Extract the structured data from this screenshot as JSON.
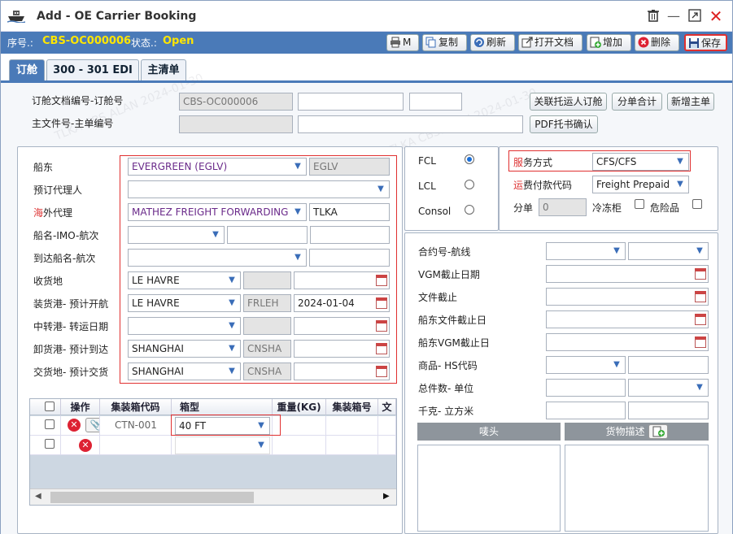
{
  "window": {
    "title_prefix": "Add",
    "title_sep": " - ",
    "title": "OE Carrier Booking"
  },
  "info": {
    "serial_label": "序号.:",
    "serial": "CBS-OC000006",
    "status_label": "状态.:",
    "status": "Open"
  },
  "toolbar": {
    "print": "M",
    "copy": "复制",
    "refresh": "刷新",
    "open_doc": "打开文档",
    "add": "增加",
    "delete": "删除",
    "save": "保存"
  },
  "tabs": [
    "订舱",
    "300 - 301 EDI",
    "主清单"
  ],
  "top": {
    "booking_doc_label": "订舱文档编号-订舱号",
    "booking_doc_no": "CBS-OC000006",
    "master_label": "主文件号-主单编号",
    "btn_link": "关联托运人订舱",
    "btn_sum": "分单合计",
    "btn_new_master": "新增主单",
    "btn_pdf": "PDF托书确认"
  },
  "left": {
    "carrier_label": "船东",
    "carrier": "EVERGREEN (EGLV)",
    "carrier_code": "EGLV",
    "agent_label": "预订代理人",
    "overseas_prefix": "海",
    "overseas_label": "外代理",
    "overseas": "MATHEZ FREIGHT FORWARDING",
    "overseas_code": "TLKA",
    "vessel_label": "船名-IMO-航次",
    "arrive_vessel_label": "到达船名-航次",
    "receipt_label": "收货地",
    "receipt": "LE HAVRE",
    "load_label": "装货港- 预计开航",
    "load": "LE HAVRE",
    "load_code": "FRLEH",
    "load_date": "2024-01-04",
    "trans_label": "中转港- 转运日期",
    "discharge_label": "卸货港- 预计到达",
    "discharge": "SHANGHAI",
    "discharge_code": "CNSHA",
    "delivery_label": "交货地- 预计交货",
    "delivery": "SHANGHAI",
    "delivery_code": "CNSHA"
  },
  "grid": {
    "headers": [
      "操作",
      "集装箱代码",
      "箱型",
      "重量(KG)",
      "集装箱号",
      "文"
    ],
    "rows": [
      {
        "code": "CTN-001",
        "type": "40 FT"
      },
      {
        "code": "",
        "type": ""
      }
    ]
  },
  "mode": {
    "fcl": "FCL",
    "lcl": "LCL",
    "consol": "Consol",
    "selected": "FCL"
  },
  "service": {
    "prefix": "服",
    "label": "务方式",
    "value": "CFS/CFS",
    "pay_prefix": "运",
    "pay_label": "费付款代码",
    "pay_value": "Freight Prepaid",
    "split_label": "分单",
    "split_value": "0",
    "reefer_label": "冷冻柜",
    "danger_label": "危险品"
  },
  "right": {
    "contract_label": "合约号-航线",
    "vgm_cut_label": "VGM截止日期",
    "doc_cut_label": "文件截止",
    "carrier_doc_cut_label": "船东文件截止日",
    "carrier_vgm_cut_label": "船东VGM截止日",
    "commodity_label": "商品-  HS代码",
    "pieces_label": "总件数- 单位",
    "kilo_label": "千克- 立方米",
    "marks_label": "唛头",
    "goods_label": "货物描述"
  },
  "watermark": "TLKA CBS.ALAN 2024-01-30"
}
